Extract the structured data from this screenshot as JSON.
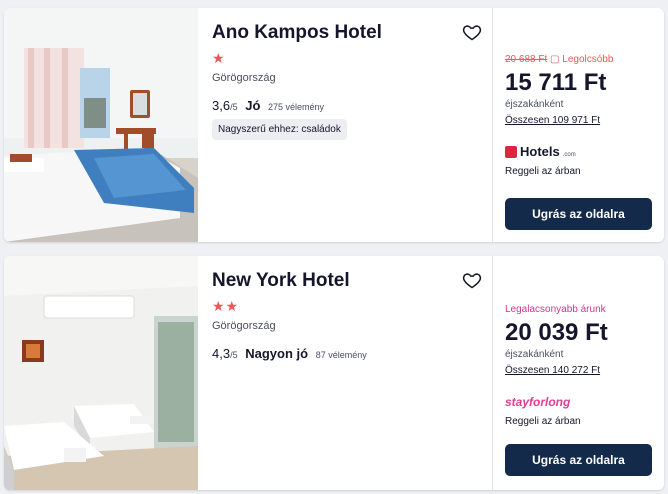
{
  "hotels": [
    {
      "name": "Ano Kampos Hotel",
      "stars": "★",
      "country": "Görögország",
      "score": "3,6",
      "score_of": "/5",
      "rating_label": "Jó",
      "reviews": "275 vélemény",
      "badge": "Nagyszerű ehhez: családok",
      "old_price": "20 688 Ft",
      "deal_label": "Legolcsóbb",
      "price": "15 711 Ft",
      "per_night": "éjszakánként",
      "total": "Összesen 109 971 Ft",
      "provider": "Hotels",
      "provider_domain": ".com",
      "breakfast": "Reggeli az árban",
      "cta": "Ugrás az oldalra"
    },
    {
      "name": "New York Hotel",
      "stars": "★★",
      "country": "Görögország",
      "score": "4,3",
      "score_of": "/5",
      "rating_label": "Nagyon jó",
      "reviews": "87 vélemény",
      "deal_label": "Legalacsonyabb árunk",
      "price": "20 039 Ft",
      "per_night": "éjszakánként",
      "total": "Összesen 140 272 Ft",
      "provider": "stayforlong",
      "breakfast": "Reggeli az árban",
      "cta": "Ugrás az oldalra"
    }
  ],
  "colors": {
    "accent_red": "#e9585a",
    "deal_pink": "#d1368b",
    "button_navy": "#142a4a"
  }
}
